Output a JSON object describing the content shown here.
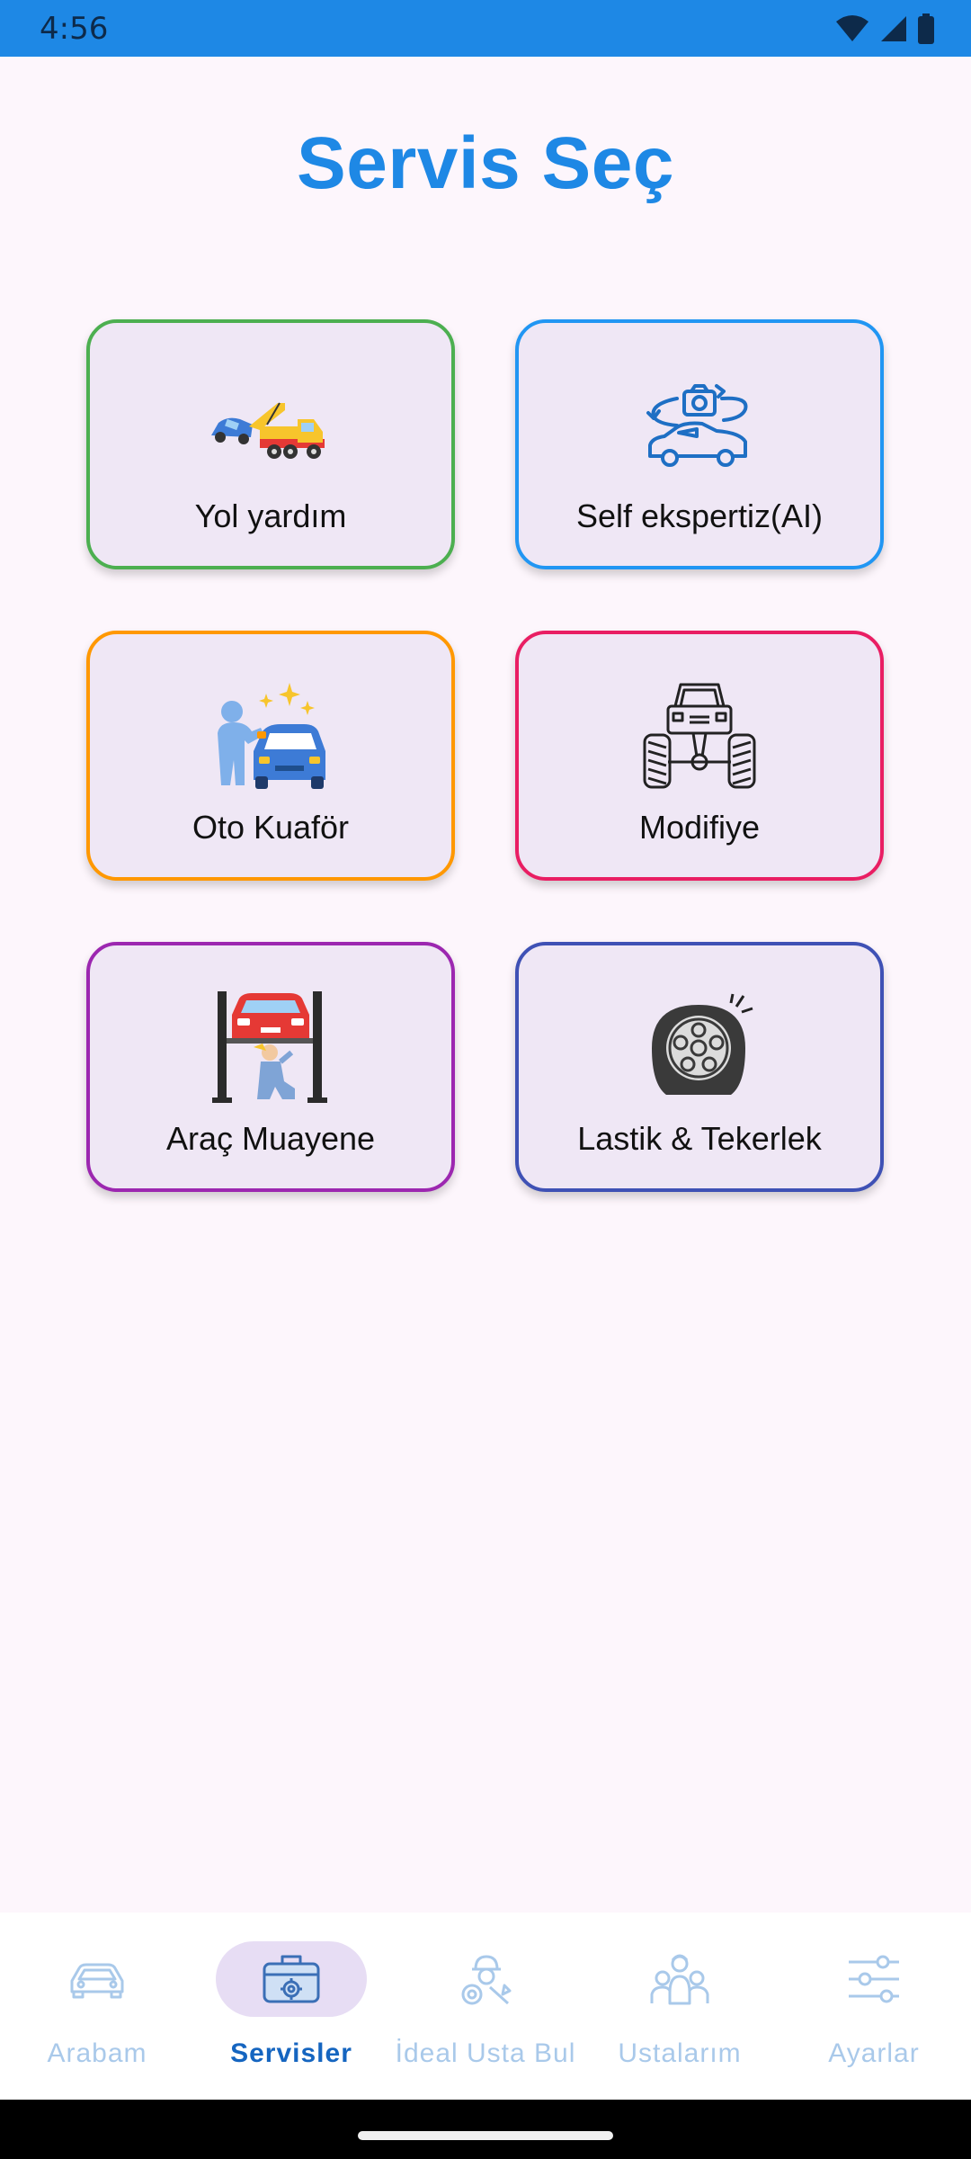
{
  "status_bar": {
    "time": "4:56",
    "icons": [
      "wifi-icon",
      "signal-icon",
      "battery-icon"
    ]
  },
  "title": "Servis Seç",
  "services": [
    {
      "label": "Yol yardım",
      "icon": "tow-truck-icon",
      "border_color": "#4caf50"
    },
    {
      "label": "Self ekspertiz(AI)",
      "icon": "car-camera-icon",
      "border_color": "#2196f3"
    },
    {
      "label": "Oto Kuaför",
      "icon": "car-wash-icon",
      "border_color": "#ff9800"
    },
    {
      "label": "Modifiye",
      "icon": "monster-truck-icon",
      "border_color": "#e91e63"
    },
    {
      "label": "Araç Muayene",
      "icon": "car-lift-icon",
      "border_color": "#9c27b0"
    },
    {
      "label": "Lastik & Tekerlek",
      "icon": "tire-icon",
      "border_color": "#3f51b5"
    }
  ],
  "bottom_nav": [
    {
      "label": "Arabam",
      "icon": "car-icon",
      "active": false
    },
    {
      "label": "Servisler",
      "icon": "toolbox-icon",
      "active": true
    },
    {
      "label": "İdeal Usta Bul",
      "icon": "mechanic-icon",
      "active": false
    },
    {
      "label": "Ustalarım",
      "icon": "team-icon",
      "active": false
    },
    {
      "label": "Ayarlar",
      "icon": "sliders-icon",
      "active": false
    }
  ],
  "colors": {
    "primary": "#1e88e5",
    "background": "#fdf6fc",
    "card_background": "#efe7f5",
    "nav_inactive": "#a9c9ea",
    "nav_active": "#1565c0"
  }
}
